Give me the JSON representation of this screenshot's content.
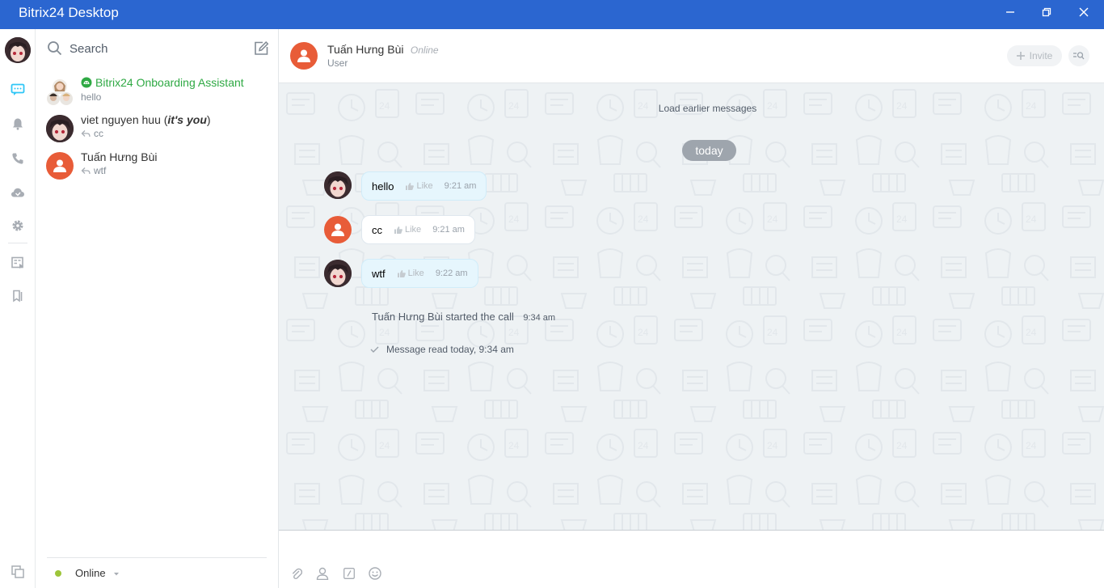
{
  "window": {
    "title": "Bitrix24 Desktop"
  },
  "search": {
    "placeholder": "Search"
  },
  "conversations": [
    {
      "name": "Bitrix24 Onboarding Assistant",
      "last": "hello"
    },
    {
      "name": "viet nguyen huu",
      "suffix_open": " (",
      "suffix_em": "it's you",
      "suffix_close": ")",
      "last": "cc"
    },
    {
      "name": "Tuấn Hưng Bùi",
      "last": "wtf"
    }
  ],
  "status": {
    "label": "Online",
    "color": "#9dc53a"
  },
  "chat": {
    "contact_name": "Tuấn Hưng Bùi",
    "contact_status": "Online",
    "contact_role": "User",
    "invite_label": "Invite",
    "load_earlier": "Load earlier messages",
    "date_divider": "today",
    "messages": [
      {
        "text": "hello",
        "like": "Like",
        "time": "9:21 am"
      },
      {
        "text": "cc",
        "like": "Like",
        "time": "9:21 am"
      },
      {
        "text": "wtf",
        "like": "Like",
        "time": "9:22 am"
      }
    ],
    "system_message": "Tuấn Hưng Bùi started the call",
    "system_time": "9:34 am",
    "read_receipt": "Message read today, 9:34 am"
  },
  "colors": {
    "titlebar": "#2b66d0",
    "accent_green": "#2fa944",
    "user_avatar": "#e85c38"
  }
}
